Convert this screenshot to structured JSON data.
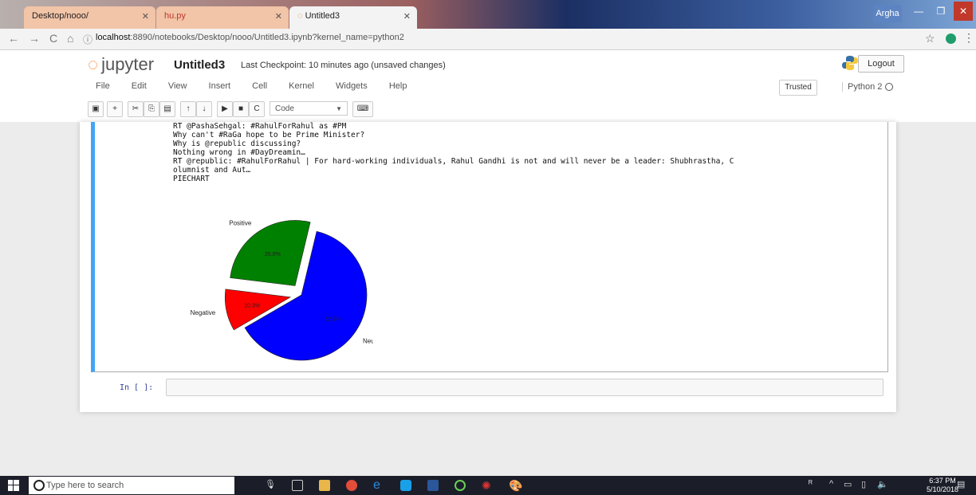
{
  "browser": {
    "tabs": [
      {
        "label": "Desktop/nooo/"
      },
      {
        "label": "hu.py"
      },
      {
        "label": "Untitled3"
      }
    ],
    "user": "Argha",
    "url_host": "localhost",
    "url_rest": ":8890/notebooks/Desktop/nooo/Untitled3.ipynb?kernel_name=python2"
  },
  "jupyter": {
    "logo": "jupyter",
    "notebook_name": "Untitled3",
    "checkpoint": "Last Checkpoint: 10 minutes ago (unsaved changes)",
    "logout": "Logout",
    "menu": [
      "File",
      "Edit",
      "View",
      "Insert",
      "Cell",
      "Kernel",
      "Widgets",
      "Help"
    ],
    "trusted": "Trusted",
    "kernel_name": "Python 2",
    "cell_type": "Code"
  },
  "output": {
    "text": "RT @PashaSehgal: #RahulForRahul as #PM\nWhy can't #RaGa hope to be Prime Minister?\nWhy is @republic discussing?\nNothing wrong in #DayDreamin…\nRT @republic: #RahulForRahul | For hard-working individuals, Rahul Gandhi is not and will never be a leader: Shubhrastha, C\nolumnist and Aut…\nPIECHART"
  },
  "chart_data": {
    "type": "pie",
    "slices": [
      {
        "label": "Positive",
        "value": 26.8,
        "pct_label": "26.8%",
        "color": "#008000"
      },
      {
        "label": "Neutral",
        "value": 62.9,
        "pct_label": "62.9%",
        "color": "#0000ff"
      },
      {
        "label": "Negative",
        "value": 10.3,
        "pct_label": "10.3%",
        "color": "#ff0000"
      }
    ]
  },
  "input_prompt": "In [ ]:",
  "taskbar": {
    "search_placeholder": "Type here to search",
    "time": "6:37 PM",
    "date": "5/10/2018"
  }
}
